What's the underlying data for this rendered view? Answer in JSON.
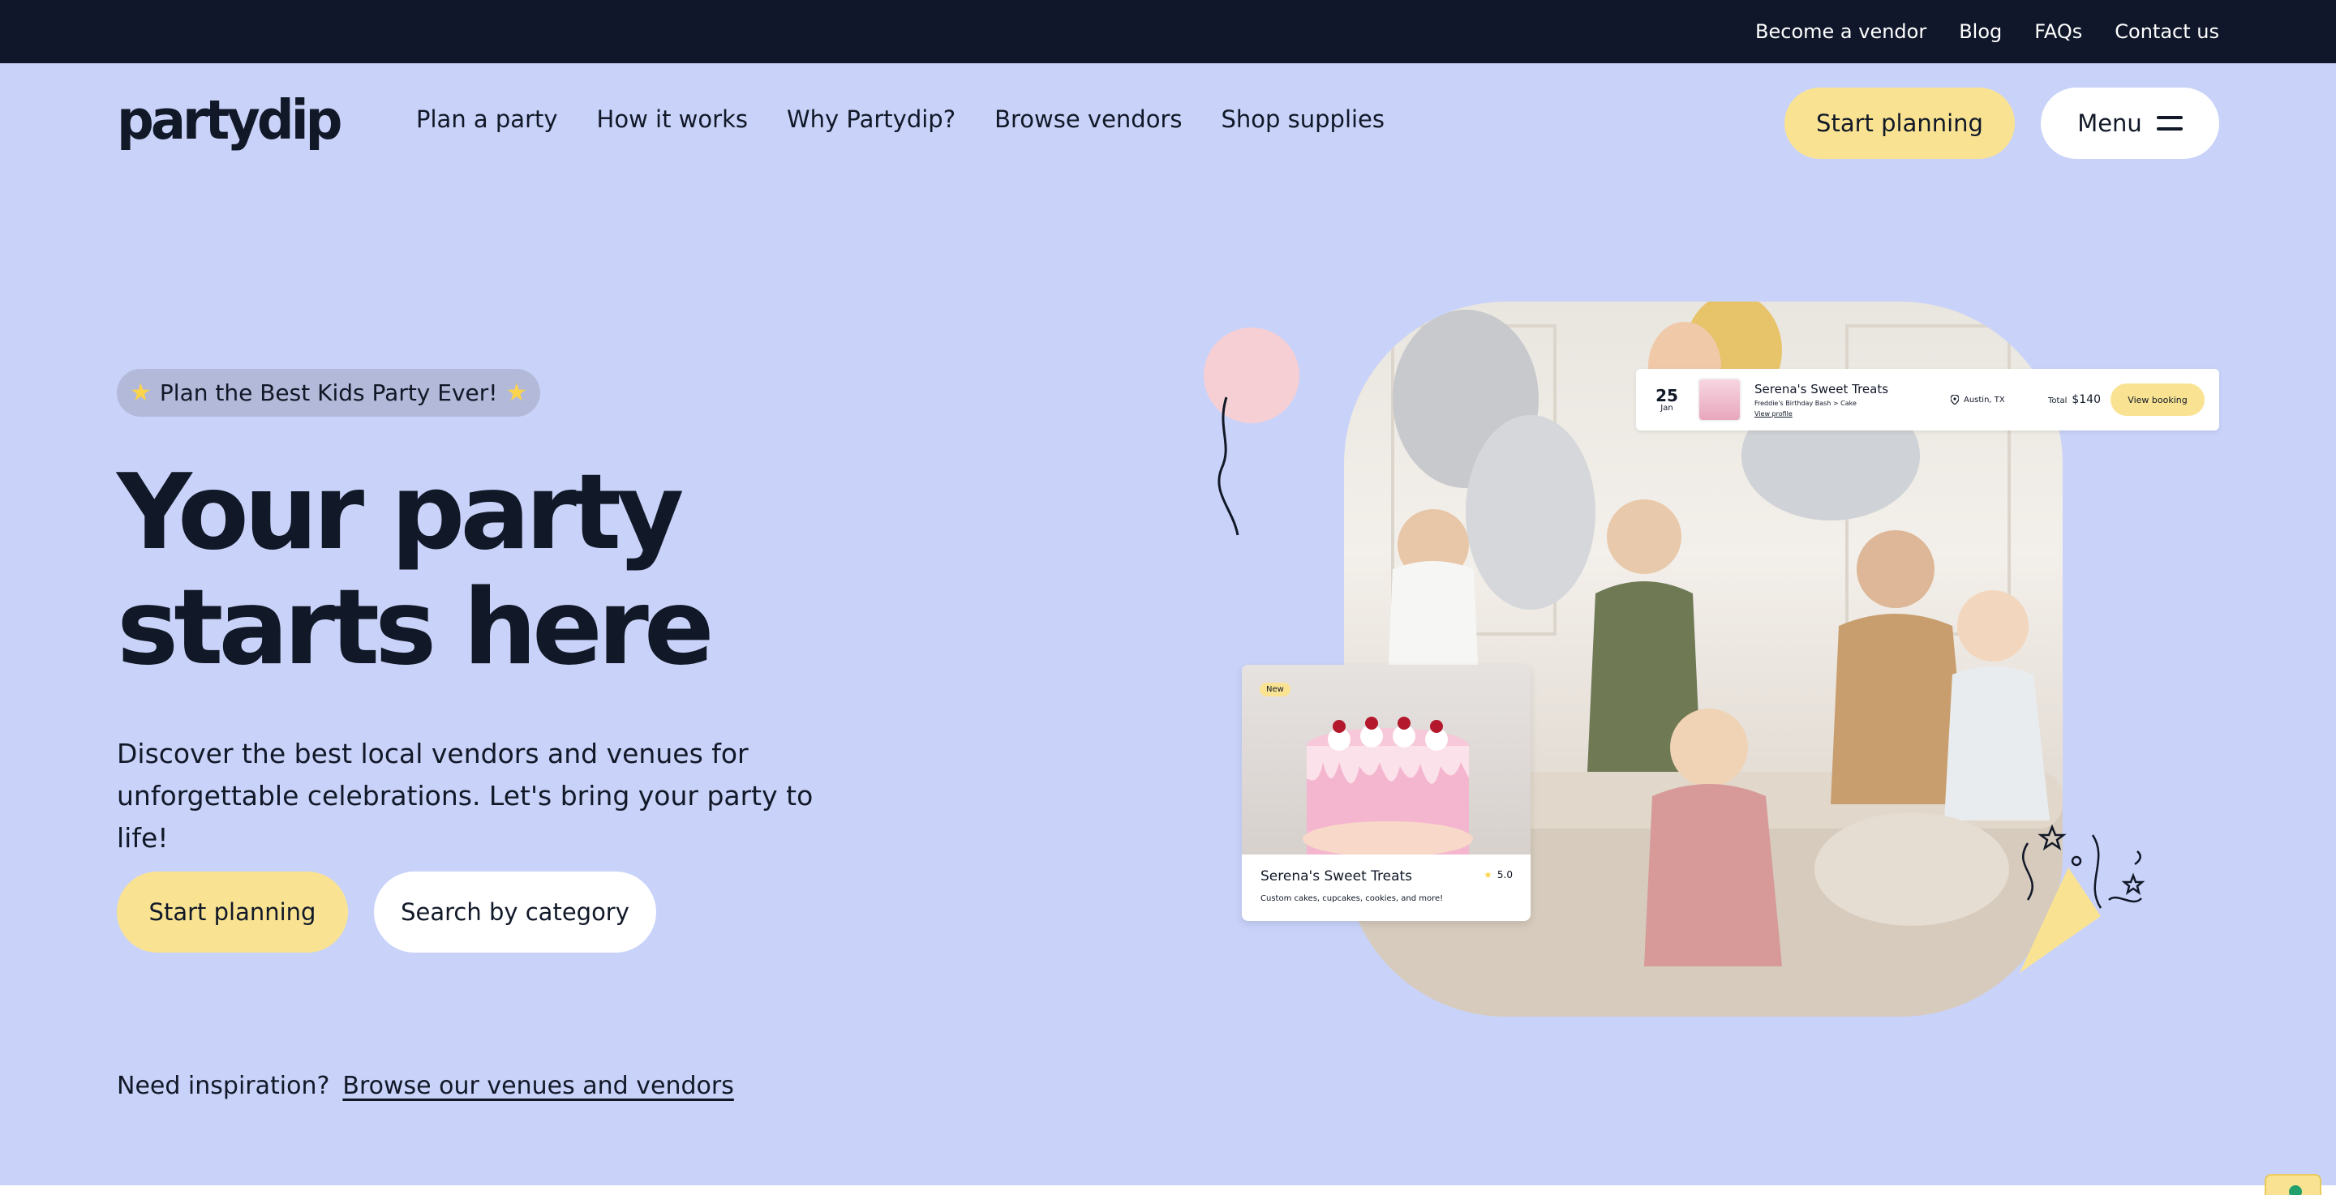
{
  "topbar": {
    "links": [
      "Become a vendor",
      "Blog",
      "FAQs",
      "Contact us"
    ]
  },
  "header": {
    "logo": "partydip",
    "nav": [
      "Plan a party",
      "How it works",
      "Why Partydip?",
      "Browse vendors",
      "Shop supplies"
    ],
    "start_label": "Start planning",
    "menu_label": "Menu"
  },
  "hero": {
    "pill_text": "Plan the Best Kids Party Ever!",
    "headline_line1": "Your party",
    "headline_line2": "starts here",
    "subtext_line1": "Discover the best local vendors and venues for",
    "subtext_line2": "unforgettable celebrations. Let's bring your party to life!",
    "cta_primary": "Start planning",
    "cta_secondary": "Search by category",
    "inspire_prefix": "Need inspiration?",
    "inspire_link": "Browse our venues and vendors"
  },
  "booking_card": {
    "day": "25",
    "month": "Jan",
    "vendor": "Serena's Sweet Treats",
    "event": "Freddie's Birthday Bash > Cake",
    "profile_link": "View profile",
    "location": "Austin, TX",
    "total_label": "Total",
    "total_value": "$140",
    "button": "View booking"
  },
  "vendor_card": {
    "badge": "New",
    "name": "Serena's Sweet Treats",
    "rating": "5.0",
    "description": "Custom cakes, cupcakes, cookies, and more!"
  },
  "colors": {
    "background": "#c9d2f9",
    "topbar": "#10172a",
    "accent_yellow": "#f9e393",
    "text": "#111827",
    "balloon_pink": "#f6cfd4"
  },
  "icons": [
    "star-icon",
    "hamburger-icon",
    "location-pin-icon",
    "chat-widget-icon"
  ]
}
